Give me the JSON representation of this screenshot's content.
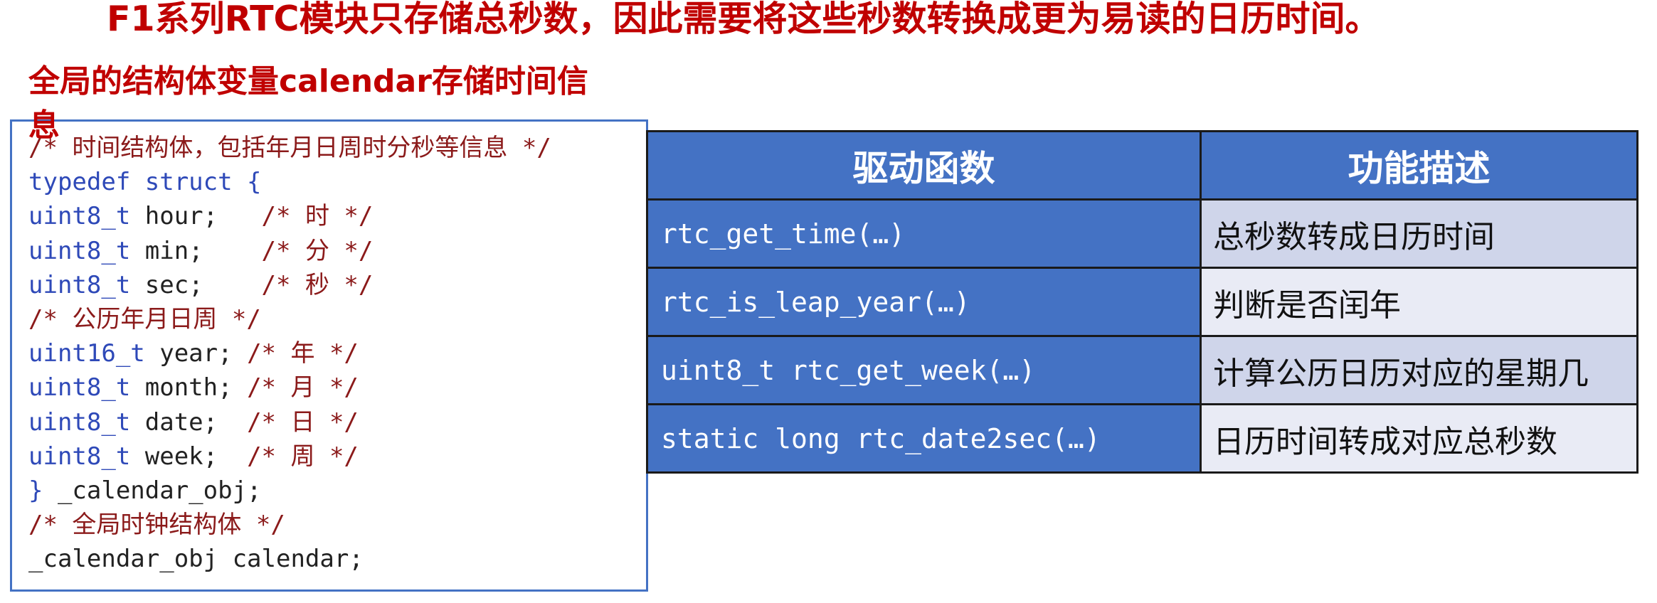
{
  "title": "F1系列RTC模块只存储总秒数，因此需要将这些秒数转换成更为易读的日历时间。",
  "subtitle": "全局的结构体变量calendar存储时间信息",
  "code_lines": [
    [
      {
        "t": "/* 时间结构体，包括年月日周时分秒等信息 */",
        "c": "cm"
      }
    ],
    [
      {
        "t": "typedef struct {",
        "c": "kw"
      }
    ],
    [
      {
        "t": "uint8_t",
        "c": "ty"
      },
      {
        "t": " hour;   ",
        "c": "tx"
      },
      {
        "t": "/* 时 */",
        "c": "cm"
      }
    ],
    [
      {
        "t": "uint8_t",
        "c": "ty"
      },
      {
        "t": " min;    ",
        "c": "tx"
      },
      {
        "t": "/* 分 */",
        "c": "cm"
      }
    ],
    [
      {
        "t": "uint8_t",
        "c": "ty"
      },
      {
        "t": " sec;    ",
        "c": "tx"
      },
      {
        "t": "/* 秒 */",
        "c": "cm"
      }
    ],
    [
      {
        "t": "/* 公历年月日周 */",
        "c": "cm"
      }
    ],
    [
      {
        "t": "uint16_t",
        "c": "ty"
      },
      {
        "t": " year; ",
        "c": "tx"
      },
      {
        "t": "/* 年 */",
        "c": "cm"
      }
    ],
    [
      {
        "t": "uint8_t",
        "c": "ty"
      },
      {
        "t": " month; ",
        "c": "tx"
      },
      {
        "t": "/* 月 */",
        "c": "cm"
      }
    ],
    [
      {
        "t": "uint8_t",
        "c": "ty"
      },
      {
        "t": " date;  ",
        "c": "tx"
      },
      {
        "t": "/* 日 */",
        "c": "cm"
      }
    ],
    [
      {
        "t": "uint8_t",
        "c": "ty"
      },
      {
        "t": " week;  ",
        "c": "tx"
      },
      {
        "t": "/* 周 */",
        "c": "cm"
      }
    ],
    [
      {
        "t": "} ",
        "c": "kw"
      },
      {
        "t": "_calendar_obj;",
        "c": "tx"
      }
    ],
    [
      {
        "t": "/* 全局时钟结构体 */",
        "c": "cm"
      }
    ],
    [
      {
        "t": "_calendar_obj calendar;",
        "c": "tx"
      }
    ]
  ],
  "table": {
    "headers": [
      "驱动函数",
      "功能描述"
    ],
    "rows": [
      {
        "fn": "rtc_get_time(…)",
        "desc": "总秒数转成日历时间"
      },
      {
        "fn": "rtc_is_leap_year(…)",
        "desc": "判断是否闰年"
      },
      {
        "fn": "uint8_t rtc_get_week(…)",
        "desc": "计算公历日历对应的星期几"
      },
      {
        "fn": "static long rtc_date2sec(…)",
        "desc": "日历时间转成对应总秒数"
      }
    ]
  },
  "colors": {
    "title": "#c00000",
    "header_bg": "#4472c4",
    "row_odd": "#cfd5ea",
    "row_even": "#e9ebf5",
    "code_comment": "#8b1a1a",
    "code_keyword": "#2e49b8"
  }
}
